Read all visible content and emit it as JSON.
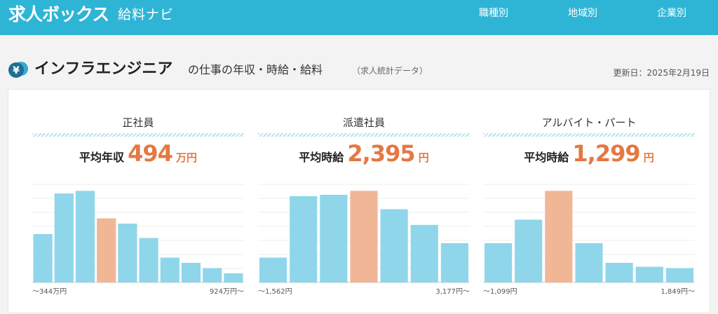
{
  "header": {
    "logo": "求人ボックス",
    "logo_sub": "給料ナビ",
    "nav": [
      "職種別",
      "地域別",
      "企業別"
    ]
  },
  "page": {
    "title_main": "インフラエンジニア",
    "title_rest": "の仕事の年収・時給・給料",
    "title_note": "（求人統計データ）",
    "updated": "更新日：2025年2月19日",
    "icon_char": "¥"
  },
  "colors": {
    "bar": "#8fd6ea",
    "highlight": "#f1b696",
    "accent": "#e57843",
    "brand": "#2eb5d6"
  },
  "chart_data": [
    {
      "type": "bar",
      "title": "正社員",
      "avg_label": "平均年収",
      "avg_value": "494",
      "avg_unit": "万円",
      "range_min_label": "～344万円",
      "range_max_label": "924万円～",
      "values": [
        37,
        68,
        70,
        49,
        45,
        34,
        19,
        15,
        11,
        7
      ],
      "highlight_index": 3,
      "ylim": [
        0,
        75
      ]
    },
    {
      "type": "bar",
      "title": "派遣社員",
      "avg_label": "平均時給",
      "avg_value": "2,395",
      "avg_unit": "円",
      "range_min_label": "～1,562円",
      "range_max_label": "3,177円～",
      "values": [
        19,
        66,
        67,
        70,
        56,
        44,
        30
      ],
      "highlight_index": 3,
      "ylim": [
        0,
        75
      ]
    },
    {
      "type": "bar",
      "title": "アルバイト・パート",
      "avg_label": "平均時給",
      "avg_value": "1,299",
      "avg_unit": "円",
      "range_min_label": "～1,099円",
      "range_max_label": "1,849円～",
      "values": [
        30,
        48,
        70,
        30,
        15,
        12,
        11
      ],
      "highlight_index": 2,
      "ylim": [
        0,
        75
      ]
    }
  ]
}
